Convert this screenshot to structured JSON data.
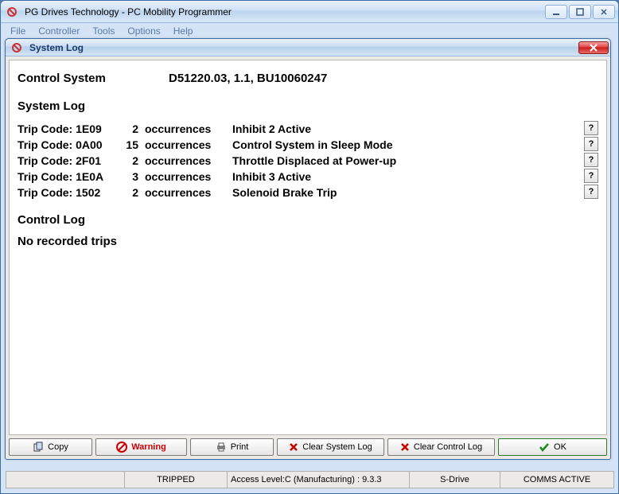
{
  "main_window": {
    "title": "PG Drives Technology - PC Mobility Programmer",
    "menu": [
      "File",
      "Controller",
      "Tools",
      "Options",
      "Help"
    ]
  },
  "child_window": {
    "title": "System Log"
  },
  "log": {
    "control_system_label": "Control System",
    "control_system_value": "D51220.03, 1.1, BU10060247",
    "system_log_heading": "System Log",
    "trips": [
      {
        "code": "1E09",
        "count": "2",
        "occ": "occurrences",
        "desc": "Inhibit 2 Active"
      },
      {
        "code": "0A00",
        "count": "15",
        "occ": "occurrences",
        "desc": "Control System in Sleep Mode"
      },
      {
        "code": "2F01",
        "count": "2",
        "occ": "occurrences",
        "desc": "Throttle Displaced at Power-up"
      },
      {
        "code": "1E0A",
        "count": "3",
        "occ": "occurrences",
        "desc": "Inhibit 3 Active"
      },
      {
        "code": "1502",
        "count": "2",
        "occ": "occurrences",
        "desc": "Solenoid Brake Trip"
      }
    ],
    "trip_code_prefix": "Trip Code: ",
    "control_log_heading": "Control Log",
    "no_recorded": "No recorded trips",
    "help_glyph": "?"
  },
  "buttons": {
    "copy": "Copy",
    "warning": "Warning",
    "print": "Print",
    "clear_system": "Clear System Log",
    "clear_control": "Clear Control Log",
    "ok": "OK"
  },
  "status": {
    "cell1": "",
    "cell2": "TRIPPED",
    "cell3": "Access Level:C (Manufacturing) : 9.3.3",
    "cell4": "S-Drive",
    "cell5": "COMMS ACTIVE"
  }
}
